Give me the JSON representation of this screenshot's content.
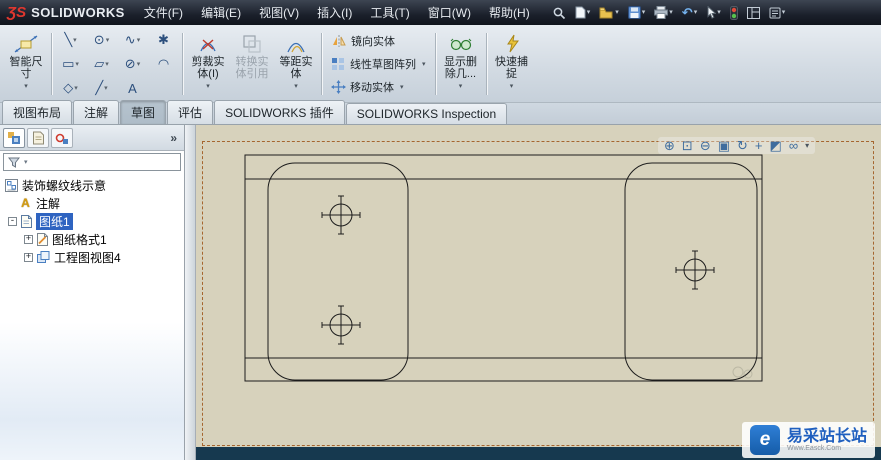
{
  "titlebar": {
    "app_name": "SOLIDWORKS",
    "menus": [
      {
        "label": "文件(F)"
      },
      {
        "label": "编辑(E)"
      },
      {
        "label": "视图(V)"
      },
      {
        "label": "插入(I)"
      },
      {
        "label": "工具(T)"
      },
      {
        "label": "窗口(W)"
      },
      {
        "label": "帮助(H)"
      }
    ],
    "quick_tool_icons": [
      "search",
      "new-document",
      "open-folder",
      "save",
      "print",
      "undo",
      "select-arrow",
      "rebuild-traffic-light",
      "panels",
      "options"
    ]
  },
  "ribbon": {
    "smart_dimension": {
      "line1": "智能尺",
      "line2": "寸"
    },
    "sketch_tools": [
      {
        "name": "line",
        "glyph": "╲"
      },
      {
        "name": "circle",
        "glyph": "⊙"
      },
      {
        "name": "spline",
        "glyph": "∿"
      },
      {
        "name": "point",
        "glyph": "✱"
      },
      {
        "name": "rectangle",
        "glyph": "▭"
      },
      {
        "name": "slot",
        "glyph": "▱"
      },
      {
        "name": "ellipse",
        "glyph": "⊘"
      },
      {
        "name": "fillet",
        "glyph": "◠"
      },
      {
        "name": "polygon",
        "glyph": "◇"
      },
      {
        "name": "centerline",
        "glyph": "╱"
      },
      {
        "name": "text",
        "glyph": "A"
      }
    ],
    "trim": {
      "line1": "剪裁实",
      "line2": "体(I)"
    },
    "convert": {
      "line1": "转换实",
      "line2": "体引用"
    },
    "offset": {
      "line1": "等距实",
      "line2": "体"
    },
    "mirror_label": "镜向实体",
    "linear_pattern_label": "线性草图阵列",
    "move_label": "移动实体",
    "display_delete": {
      "line1": "显示删",
      "line2": "除几..."
    },
    "quick_snap": {
      "line1": "快速捕",
      "line2": "捉"
    }
  },
  "tabs": {
    "items": [
      {
        "label": "视图布局",
        "active": false
      },
      {
        "label": "注解",
        "active": false
      },
      {
        "label": "草图",
        "active": true
      },
      {
        "label": "评估",
        "active": false
      },
      {
        "label": "SOLIDWORKS 插件",
        "active": false
      },
      {
        "label": "SOLIDWORKS Inspection",
        "active": false
      }
    ]
  },
  "panel": {
    "tab_icons": [
      "featuremanager-tree",
      "propertymanager",
      "configurationmanager"
    ],
    "collapse": "»",
    "tree": [
      {
        "label": "装饰螺纹线示意",
        "icon": "drawing-document",
        "selected": false
      },
      {
        "label": "注解",
        "icon": "annotations",
        "selected": false
      },
      {
        "label": "图纸1",
        "icon": "sheet",
        "selected": true,
        "expand": "-"
      },
      {
        "label": "图纸格式1",
        "icon": "sheet-format",
        "selected": false,
        "expand": "+"
      },
      {
        "label": "工程图视图4",
        "icon": "drawing-view",
        "selected": false,
        "expand": "+"
      }
    ]
  },
  "hud": {
    "icons": [
      {
        "name": "zoom-to-fit",
        "glyph": "⊕"
      },
      {
        "name": "zoom-to-area",
        "glyph": "⊡"
      },
      {
        "name": "zoom-in-out",
        "glyph": "⊖"
      },
      {
        "name": "view-orientation",
        "glyph": "▣"
      },
      {
        "name": "rotate-view",
        "glyph": "↻"
      },
      {
        "name": "pan",
        "glyph": "+"
      },
      {
        "name": "display-style",
        "glyph": "◩"
      },
      {
        "name": "hide-show-items",
        "glyph": "∞"
      }
    ]
  },
  "watermark": {
    "title": "易采站长站",
    "subtitle": "Www.Easck.Com"
  },
  "colors": {
    "selection_blue": "#2f64c1",
    "sheet_beige": "#d7d2bc",
    "sheet_dashed_border": "#a5662f",
    "titlebar_dark": "#1b202b",
    "bottom_strip": "#16394f",
    "watermark_blue": "#1f5fbf"
  }
}
